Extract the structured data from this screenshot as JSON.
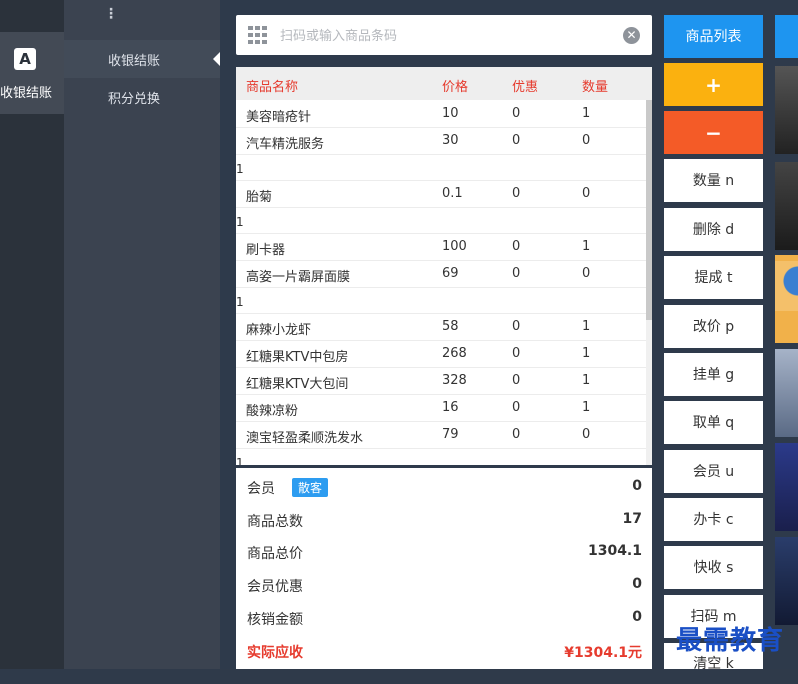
{
  "nav": {
    "main_item": "收银结账",
    "sub_items": [
      "收银结账",
      "积分兑换"
    ],
    "dots": "⋮"
  },
  "search": {
    "placeholder": "扫码或输入商品条码"
  },
  "table": {
    "headers": [
      "商品名称",
      "价格",
      "优惠",
      "数量"
    ],
    "rows": [
      {
        "name": "美容暗疮针",
        "price": "10",
        "discount": "0",
        "qty": "1",
        "extra": ""
      },
      {
        "name": "汽车精洗服务",
        "price": "30",
        "discount": "0",
        "qty": "0",
        "extra": "1"
      },
      {
        "name": "胎菊",
        "price": "0.1",
        "discount": "0",
        "qty": "0",
        "extra": "1"
      },
      {
        "name": "刷卡器",
        "price": "100",
        "discount": "0",
        "qty": "1",
        "extra": ""
      },
      {
        "name": "高姿一片霸屏面膜",
        "price": "69",
        "discount": "0",
        "qty": "0",
        "extra": "1"
      },
      {
        "name": "麻辣小龙虾",
        "price": "58",
        "discount": "0",
        "qty": "1",
        "extra": ""
      },
      {
        "name": "红糖果KTV中包房",
        "price": "268",
        "discount": "0",
        "qty": "1",
        "extra": ""
      },
      {
        "name": "红糖果KTV大包间",
        "price": "328",
        "discount": "0",
        "qty": "1",
        "extra": ""
      },
      {
        "name": "酸辣凉粉",
        "price": "16",
        "discount": "0",
        "qty": "1",
        "extra": ""
      },
      {
        "name": "澳宝轻盈柔顺洗发水",
        "price": "79",
        "discount": "0",
        "qty": "0",
        "extra": "1"
      }
    ]
  },
  "summary": {
    "member_label": "会员",
    "member_badge": "散客",
    "member_value": "0",
    "total_items_label": "商品总数",
    "total_items_value": "17",
    "total_price_label": "商品总价",
    "total_price_value": "1304.1",
    "member_discount_label": "会员优惠",
    "member_discount_value": "0",
    "writeoff_label": "核销金额",
    "writeoff_value": "0",
    "payable_label": "实际应收",
    "payable_value": "¥1304.1元"
  },
  "buttons": {
    "product_list": "商品列表",
    "plus": "+",
    "minus": "−",
    "quantity": "数量 n",
    "delete": "删除 d",
    "commission": "提成 t",
    "change_price": "改价 p",
    "hang_order": "挂单 g",
    "take_order": "取单 q",
    "member": "会员 u",
    "card": "办卡 c",
    "quick_pay": "快收 s",
    "scan": "扫码 m",
    "clear": "清空 k"
  },
  "watermark": "最需教育",
  "colors": {
    "accent_blue": "#1e95f0",
    "plus_yellow": "#fbb10f",
    "minus_orange": "#f45b27",
    "header_red": "#e63b2e",
    "nav_dark": "#2b323b"
  }
}
